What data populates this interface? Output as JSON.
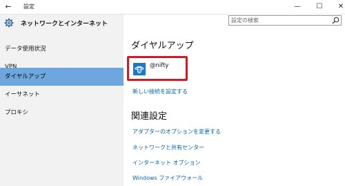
{
  "window": {
    "title": "設定",
    "back_glyph": "←",
    "minimize_glyph": "—",
    "maximize_glyph": "☐",
    "close_glyph": "✕"
  },
  "sidebar": {
    "header": "ネットワークとインターネット",
    "items": [
      {
        "label": "データ使用状況",
        "active": false
      },
      {
        "label": "VPN",
        "active": false
      },
      {
        "label": "ダイヤルアップ",
        "active": true
      },
      {
        "label": "イーサネット",
        "active": false
      },
      {
        "label": "プロキシ",
        "active": false
      }
    ]
  },
  "search": {
    "placeholder": "設定の検索"
  },
  "main": {
    "title": "ダイヤルアップ",
    "connection": {
      "name": "@nifty",
      "icon": "dialup-phone-icon"
    },
    "new_connection_link": "新しい接続を設定する",
    "related_title": "関連設定",
    "related_links": [
      "アダプターのオプションを変更する",
      "ネットワークと共有センター",
      "インターネット オプション",
      "Windows ファイアウォール"
    ]
  },
  "colors": {
    "accent": "#0063b1",
    "selected_nav": "#6ea7dd",
    "highlight_border": "#e0141e",
    "tile": "#1c78c8",
    "sidebar_bg": "#f2f2f2"
  }
}
